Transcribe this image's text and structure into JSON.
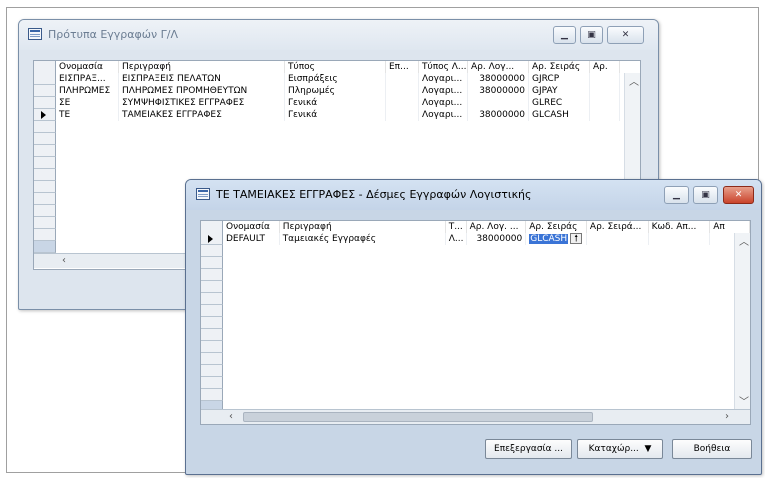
{
  "window1": {
    "title": "Πρότυπα Εγγραφών Γ/Λ",
    "columns": [
      "Ονομασία",
      "Περιγραφή",
      "Τύπος",
      "Επ...",
      "Τύπος Λ...",
      "Αρ. Λογ...",
      "Αρ. Σειράς",
      "Αρ."
    ],
    "rows": [
      [
        "ΕΙΣΠΡΑΞ...",
        "ΕΙΣΠΡΑΞΕΙΣ ΠΕΛΑΤΩΝ",
        "Εισπράξεις",
        "",
        "Λογαρι...",
        "38000000",
        "GJRCP",
        ""
      ],
      [
        "ΠΛΗΡΩΜΕΣ",
        "ΠΛΗΡΩΜΕΣ ΠΡΟΜΗΘΕΥΤΩΝ",
        "Πληρωμές",
        "",
        "Λογαρι...",
        "38000000",
        "GJPAY",
        ""
      ],
      [
        "ΣΕ",
        "ΣΥΜΨΗΦΙΣΤΙΚΕΣ ΕΓΓΡΑΦΕΣ",
        "Γενικά",
        "",
        "Λογαρι...",
        "",
        "GLREC",
        ""
      ],
      [
        "ΤΕ",
        "ΤΑΜΕΙΑΚΕΣ ΕΓΓΡΑΦΕΣ",
        "Γενικά",
        "",
        "Λογαρι...",
        "38000000",
        "GLCASH",
        ""
      ]
    ]
  },
  "window2": {
    "title": "ΤΕ ΤΑΜΕΙΑΚΕΣ ΕΓΓΡΑΦΕΣ - Δέσμες Εγγραφών Λογιστικής",
    "columns": [
      "Ονομασία",
      "Περιγραφή",
      "Τ...",
      "Αρ. Λογ. ...",
      "Αρ. Σειράς",
      "Αρ. Σειρά...",
      "Κωδ. Απ...",
      "Απ"
    ],
    "rows": [
      [
        "DEFAULT",
        "Ταμειακές Εγγραφές",
        "Λ...",
        "38000000",
        "GLCASH",
        "",
        "",
        ""
      ]
    ],
    "buttons": {
      "edit": "Επεξεργασία ...",
      "register": "Καταχώρ...",
      "help": "Βοήθεια"
    }
  },
  "icons": {
    "minimize": "minimize-icon",
    "maximize": "maximize-icon",
    "close": "close-icon",
    "row_pointer": "row-pointer-icon",
    "lookup": "lookup-arrow-icon"
  },
  "colors": {
    "selection": "#3a74d6",
    "close_button": "#c9432c"
  }
}
